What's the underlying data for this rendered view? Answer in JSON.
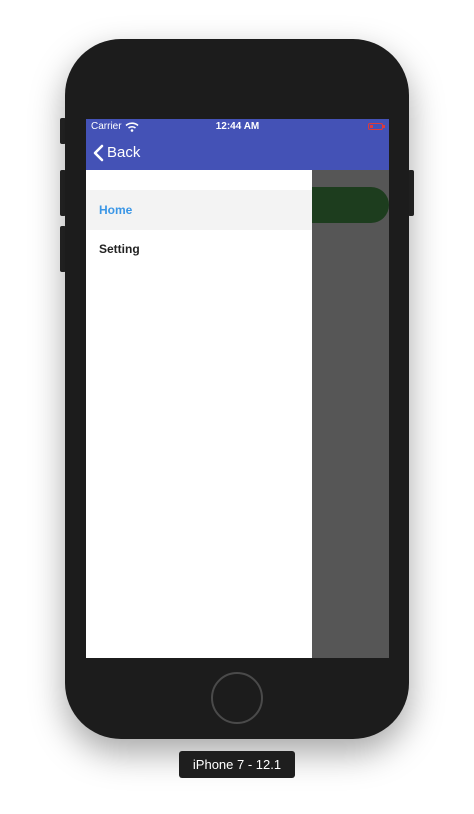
{
  "device": {
    "label": "iPhone 7 - 12.1"
  },
  "status_bar": {
    "carrier": "Carrier",
    "time": "12:44 AM",
    "wifi_icon": "wifi-icon",
    "battery_icon": "battery-low-icon"
  },
  "nav": {
    "back_label": "Back",
    "back_icon": "chevron-left-icon"
  },
  "drawer": {
    "items": [
      {
        "label": "Home",
        "selected": true
      },
      {
        "label": "Setting",
        "selected": false
      }
    ]
  },
  "colors": {
    "header": "#4452b6",
    "selected_text": "#3a96e6",
    "overlay": "#565656",
    "pill": "#1d3d1e",
    "battery": "#e03a3a"
  }
}
